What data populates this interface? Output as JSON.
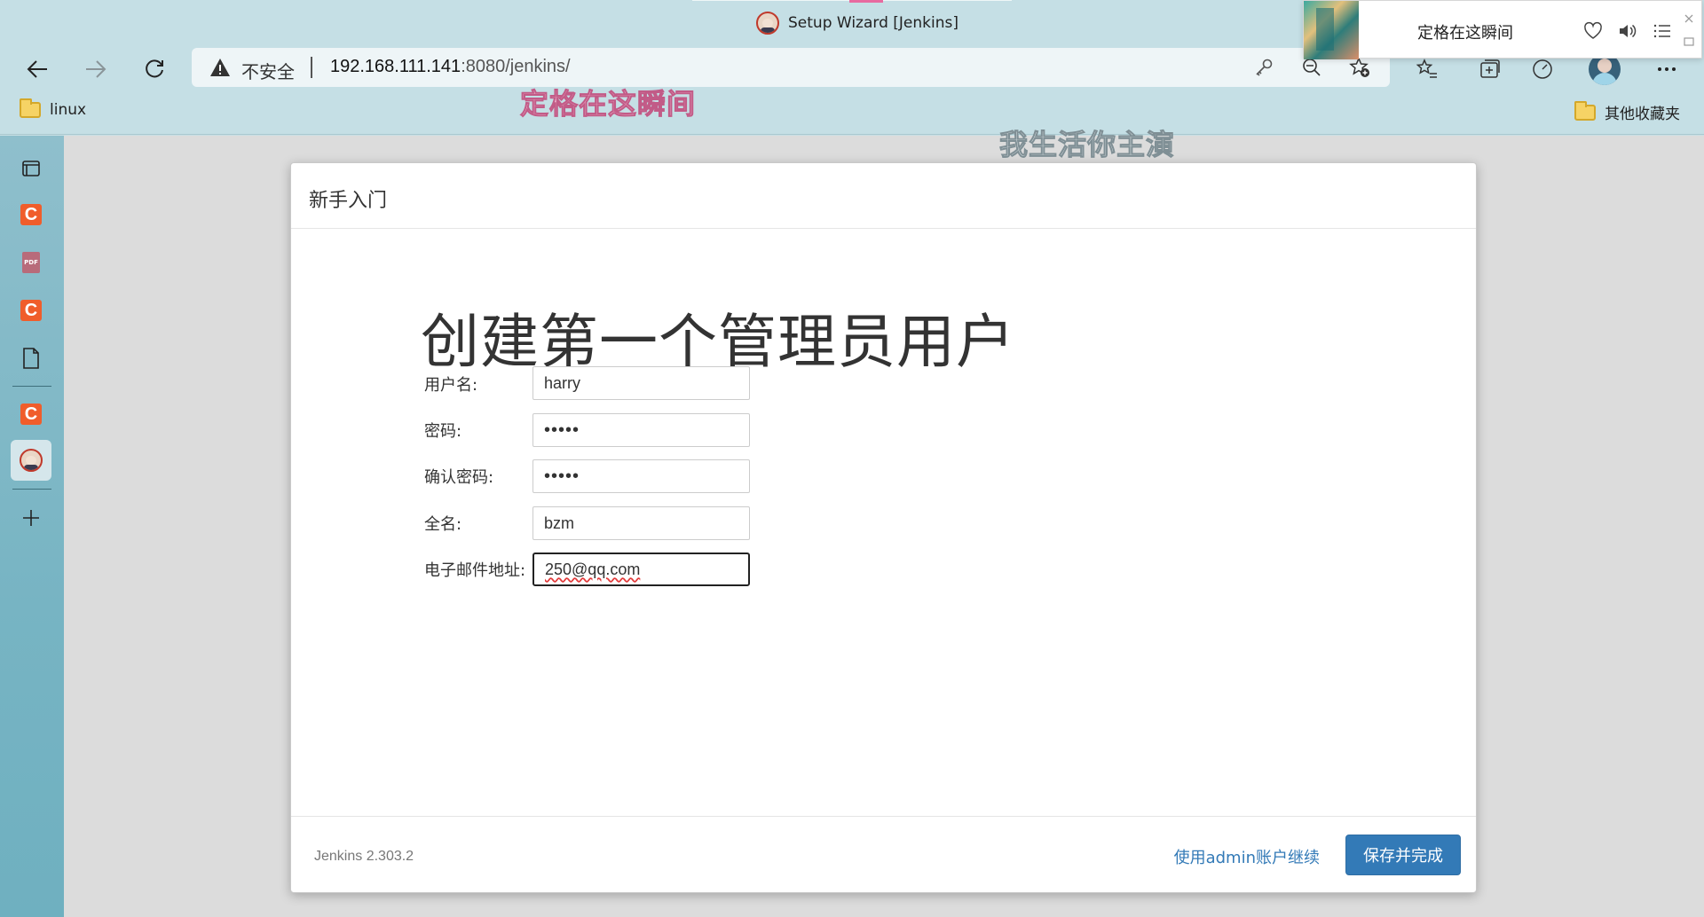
{
  "window": {
    "title": "Setup Wizard [Jenkins]"
  },
  "toolbar": {
    "security_label": "不安全",
    "url_host": "192.168.111.141",
    "url_path": ":8080/jenkins/"
  },
  "bookmarks": {
    "left_folder": "linux",
    "right_folder": "其他收藏夹"
  },
  "overlay": {
    "lyric_line_1": "定格在这瞬间",
    "lyric_line_2": "我生活你主演"
  },
  "music_player": {
    "song_title": "定格在这瞬间"
  },
  "sidebar": {
    "items": [
      "tab-manager",
      "csdn",
      "pdf",
      "csdn",
      "document",
      "csdn",
      "jenkins",
      "add"
    ],
    "csdn_letter": "C",
    "pdf_text": "PDF"
  },
  "dialog": {
    "header": "新手入门",
    "heading": "创建第一个管理员用户",
    "fields": [
      {
        "label": "用户名:",
        "value": "harry"
      },
      {
        "label": "密码:",
        "value": "•••••"
      },
      {
        "label": "确认密码:",
        "value": "•••••"
      },
      {
        "label": "全名:",
        "value": "bzm"
      },
      {
        "label": "电子邮件地址:",
        "value": "250@qq.com"
      }
    ],
    "version": "Jenkins 2.303.2",
    "continue_as_admin": "使用admin账户继续",
    "save_button": "保存并完成"
  },
  "colors": {
    "accent": "#337ab7",
    "browser_chrome": "#c5dfe5",
    "csdn_red": "#f05d2b"
  }
}
